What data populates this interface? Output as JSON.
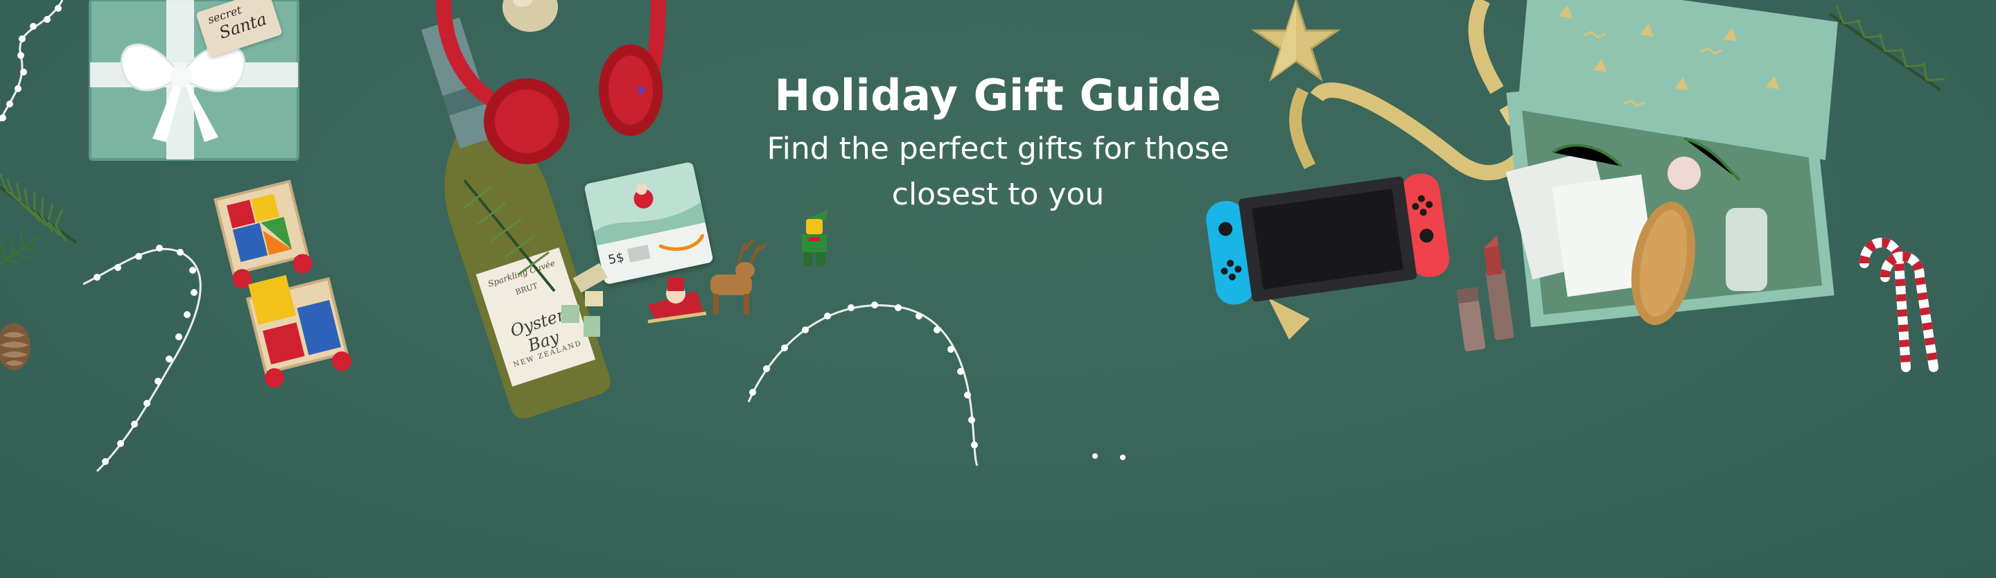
{
  "banner": {
    "title": "Holiday Gift Guide",
    "subtitle": "Find the perfect gifts for those closest to you",
    "background_color": "#3b6658"
  },
  "gift_tag": {
    "line1": "secret",
    "line2": "Santa"
  },
  "wine": {
    "label_top": "Sparkling Cuvée",
    "label_mid": "BRUT",
    "label_brand": "Oyster Bay",
    "label_bottom": "NEW ZEALAND"
  },
  "gift_card": {
    "amount": "5$"
  },
  "icons": {
    "gift_box": "gift-box-icon",
    "wine_bottle": "wine-bottle-icon",
    "headphones": "headphones-icon",
    "toy_train": "toy-train-icon",
    "gift_card": "gift-card-icon",
    "reindeer": "reindeer-sleigh-icon",
    "elf": "elf-figure-icon",
    "game_console": "game-console-icon",
    "lipstick": "lipstick-icon",
    "beauty_box": "beauty-gift-box-icon",
    "candy_cane": "candy-cane-icon",
    "star": "star-ornament-icon",
    "pine_cone": "pine-cone-icon",
    "string_lights": "string-lights-icon"
  },
  "colors": {
    "red": "#c8202f",
    "gold": "#d9c27a",
    "mint": "#8fc4b0",
    "switch_blue": "#19b5e6",
    "switch_red": "#f0424a"
  }
}
